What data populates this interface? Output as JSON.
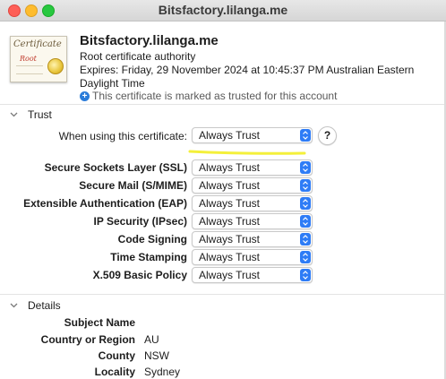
{
  "window": {
    "title": "Bitsfactory.lilanga.me"
  },
  "certificate": {
    "icon_word": "Certificate",
    "icon_root": "Root",
    "name": "Bitsfactory.lilanga.me",
    "type": "Root certificate authority",
    "expires": "Expires: Friday, 29 November 2024 at 10:45:37 PM Australian Eastern Daylight Time",
    "trusted_note": "This certificate is marked as trusted for this account"
  },
  "trust": {
    "heading": "Trust",
    "when_using_label": "When using this certificate:",
    "when_using_value": "Always Trust",
    "help_label": "?",
    "rows": [
      {
        "label": "Secure Sockets Layer (SSL)",
        "value": "Always Trust"
      },
      {
        "label": "Secure Mail (S/MIME)",
        "value": "Always Trust"
      },
      {
        "label": "Extensible Authentication (EAP)",
        "value": "Always Trust"
      },
      {
        "label": "IP Security (IPsec)",
        "value": "Always Trust"
      },
      {
        "label": "Code Signing",
        "value": "Always Trust"
      },
      {
        "label": "Time Stamping",
        "value": "Always Trust"
      },
      {
        "label": "X.509 Basic Policy",
        "value": "Always Trust"
      }
    ]
  },
  "details": {
    "heading": "Details",
    "subject_heading": "Subject Name",
    "rows": [
      {
        "label": "Country or Region",
        "value": "AU"
      },
      {
        "label": "County",
        "value": "NSW"
      },
      {
        "label": "Locality",
        "value": "Sydney"
      }
    ]
  },
  "colors": {
    "accent": "#2e7cf6",
    "highlight": "#f4f03a"
  }
}
